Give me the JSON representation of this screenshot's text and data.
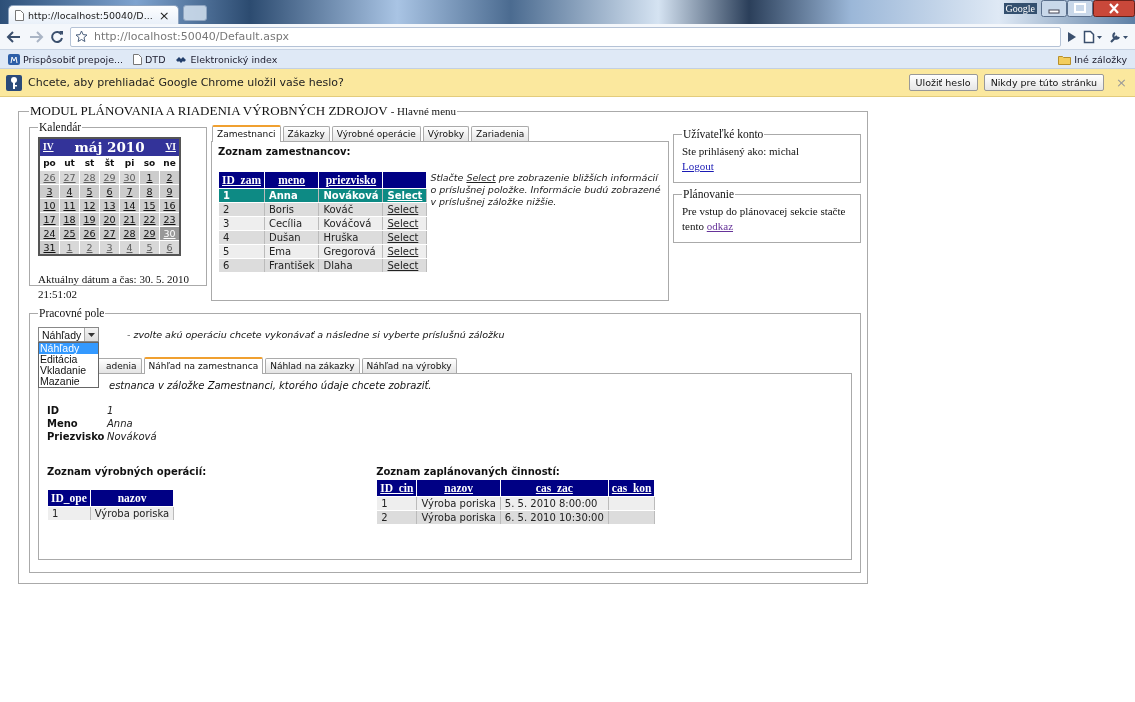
{
  "browser": {
    "tab_title": "http://localhost:50040/D...",
    "tab_close": "×",
    "brand": "Google",
    "url": "http://localhost:50040/Default.aspx",
    "bookmarks": [
      "Prispôsobiť prepoje...",
      "DTD",
      "Elektronický index"
    ],
    "other_bookmarks": "Iné záložky",
    "infobar": {
      "message": "Chcete, aby prehliadač Google Chrome uložil vaše heslo?",
      "buttons": [
        "Uložiť heslo",
        "Nikdy pre túto stránku"
      ],
      "close": "×"
    }
  },
  "page": {
    "title": "MODUL PLÁNOVANIA A RIADENIA VÝROBNÝCH ZDROJOV",
    "subtitle": "- Hlavné menu",
    "calendar": {
      "legend": "Kalendár",
      "prev": "IV",
      "month": "máj 2010",
      "next": "VI",
      "weekdays": [
        "po",
        "ut",
        "st",
        "št",
        "pi",
        "so",
        "ne"
      ],
      "weeks": [
        [
          {
            "day": "26",
            "other_month": true,
            "selected": false
          },
          {
            "day": "27",
            "other_month": true,
            "selected": false
          },
          {
            "day": "28",
            "other_month": true,
            "selected": false
          },
          {
            "day": "29",
            "other_month": true,
            "selected": false
          },
          {
            "day": "30",
            "other_month": true,
            "selected": false
          },
          {
            "day": "1",
            "other_month": false,
            "selected": false
          },
          {
            "day": "2",
            "other_month": false,
            "selected": false
          }
        ],
        [
          {
            "day": "3",
            "other_month": false,
            "selected": false
          },
          {
            "day": "4",
            "other_month": false,
            "selected": false
          },
          {
            "day": "5",
            "other_month": false,
            "selected": false
          },
          {
            "day": "6",
            "other_month": false,
            "selected": false
          },
          {
            "day": "7",
            "other_month": false,
            "selected": false
          },
          {
            "day": "8",
            "other_month": false,
            "selected": false
          },
          {
            "day": "9",
            "other_month": false,
            "selected": false
          }
        ],
        [
          {
            "day": "10",
            "other_month": false,
            "selected": false
          },
          {
            "day": "11",
            "other_month": false,
            "selected": false
          },
          {
            "day": "12",
            "other_month": false,
            "selected": false
          },
          {
            "day": "13",
            "other_month": false,
            "selected": false
          },
          {
            "day": "14",
            "other_month": false,
            "selected": false
          },
          {
            "day": "15",
            "other_month": false,
            "selected": false
          },
          {
            "day": "16",
            "other_month": false,
            "selected": false
          }
        ],
        [
          {
            "day": "17",
            "other_month": false,
            "selected": false
          },
          {
            "day": "18",
            "other_month": false,
            "selected": false
          },
          {
            "day": "19",
            "other_month": false,
            "selected": false
          },
          {
            "day": "20",
            "other_month": false,
            "selected": false
          },
          {
            "day": "21",
            "other_month": false,
            "selected": false
          },
          {
            "day": "22",
            "other_month": false,
            "selected": false
          },
          {
            "day": "23",
            "other_month": false,
            "selected": false
          }
        ],
        [
          {
            "day": "24",
            "other_month": false,
            "selected": false
          },
          {
            "day": "25",
            "other_month": false,
            "selected": false
          },
          {
            "day": "26",
            "other_month": false,
            "selected": false
          },
          {
            "day": "27",
            "other_month": false,
            "selected": false
          },
          {
            "day": "28",
            "other_month": false,
            "selected": false
          },
          {
            "day": "29",
            "other_month": false,
            "selected": false
          },
          {
            "day": "30",
            "other_month": false,
            "selected": true
          }
        ],
        [
          {
            "day": "31",
            "other_month": false,
            "selected": false
          },
          {
            "day": "1",
            "other_month": true,
            "selected": false
          },
          {
            "day": "2",
            "other_month": true,
            "selected": false
          },
          {
            "day": "3",
            "other_month": true,
            "selected": false
          },
          {
            "day": "4",
            "other_month": true,
            "selected": false
          },
          {
            "day": "5",
            "other_month": true,
            "selected": false
          },
          {
            "day": "6",
            "other_month": true,
            "selected": false
          }
        ]
      ],
      "current": "Aktuálny dátum a čas: 30. 5. 2010 21:51:02"
    },
    "employees": {
      "tabs": [
        {
          "label": "Zamestnanci",
          "selected": true
        },
        {
          "label": "Zákazky",
          "selected": false
        },
        {
          "label": "Výrobné operácie",
          "selected": false
        },
        {
          "label": "Výrobky",
          "selected": false
        },
        {
          "label": "Zariadenia",
          "selected": false
        }
      ],
      "heading": "Zoznam zamestnancov:",
      "sortable": true,
      "columns": [
        "ID_zam",
        "meno",
        "priezvisko"
      ],
      "rows": [
        {
          "cells": [
            "1",
            "Anna",
            "Nováková"
          ],
          "action": "Select",
          "selected": true
        },
        {
          "cells": [
            "2",
            "Boris",
            "Kováč"
          ],
          "action": "Select",
          "selected": false
        },
        {
          "cells": [
            "3",
            "Cecília",
            "Kováčová"
          ],
          "action": "Select",
          "selected": false
        },
        {
          "cells": [
            "4",
            "Dušan",
            "Hruška"
          ],
          "action": "Select",
          "selected": false
        },
        {
          "cells": [
            "5",
            "Ema",
            "Gregorová"
          ],
          "action": "Select",
          "selected": false
        },
        {
          "cells": [
            "6",
            "František",
            "Dlaha"
          ],
          "action": "Select",
          "selected": false
        }
      ],
      "note": {
        "before": "Stlačte ",
        "link": "Select",
        "after": " pre zobrazenie bližších informácií o príslušnej položke. Informácie budú zobrazené v príslušnej záložke nižšie."
      }
    },
    "account": {
      "legend": "Užívateľké konto",
      "text": "Ste prihlásený ako: michal",
      "link": "Logout"
    },
    "planning": {
      "legend": "Plánovanie",
      "text": "Pre vstup do plánovacej sekcie stačte tento ",
      "link": "odkaz"
    },
    "workspace": {
      "legend": "Pracovné pole",
      "dropdown": {
        "value": "Náhľady",
        "options": [
          {
            "label": "Náhľady",
            "selected": true
          },
          {
            "label": "Editácia",
            "selected": false
          },
          {
            "label": "Vkladanie",
            "selected": false
          },
          {
            "label": "Mazanie",
            "selected": false
          }
        ]
      },
      "hint": "- zvolte akú operáciu chcete vykonávať a následne si vyberte príslušnú záložku",
      "tabs": [
        {
          "label": "adenia",
          "selected": false
        },
        {
          "label": "Náhľad na zamestnanca",
          "selected": true
        },
        {
          "label": "Náhlad na zákazky",
          "selected": false
        },
        {
          "label": "Náhľad na výrobky",
          "selected": false
        }
      ],
      "instruction": "estnanca v záložke Zamestnanci, ktorého údaje chcete zobraziť.",
      "details": [
        {
          "label": "ID",
          "value": "1"
        },
        {
          "label": "Meno",
          "value": "Anna"
        },
        {
          "label": "Priezvisko",
          "value": "Nováková"
        }
      ],
      "operations": {
        "title": "Zoznam výrobných operácií:",
        "sortable": false,
        "columns": [
          "ID_ope",
          "nazov"
        ],
        "rows": [
          [
            "1",
            "Výroba poriska"
          ]
        ]
      },
      "activities": {
        "title": "Zoznam zaplánovaných činností:",
        "sortable": true,
        "columns": [
          "ID_cin",
          "nazov",
          "cas_zac",
          "cas_kon"
        ],
        "rows": [
          [
            "1",
            "Výroba poriska",
            "5. 5. 2010 8:00:00",
            ""
          ],
          [
            "2",
            "Výroba poriska",
            "6. 5. 2010 10:30:00",
            ""
          ]
        ]
      }
    }
  }
}
